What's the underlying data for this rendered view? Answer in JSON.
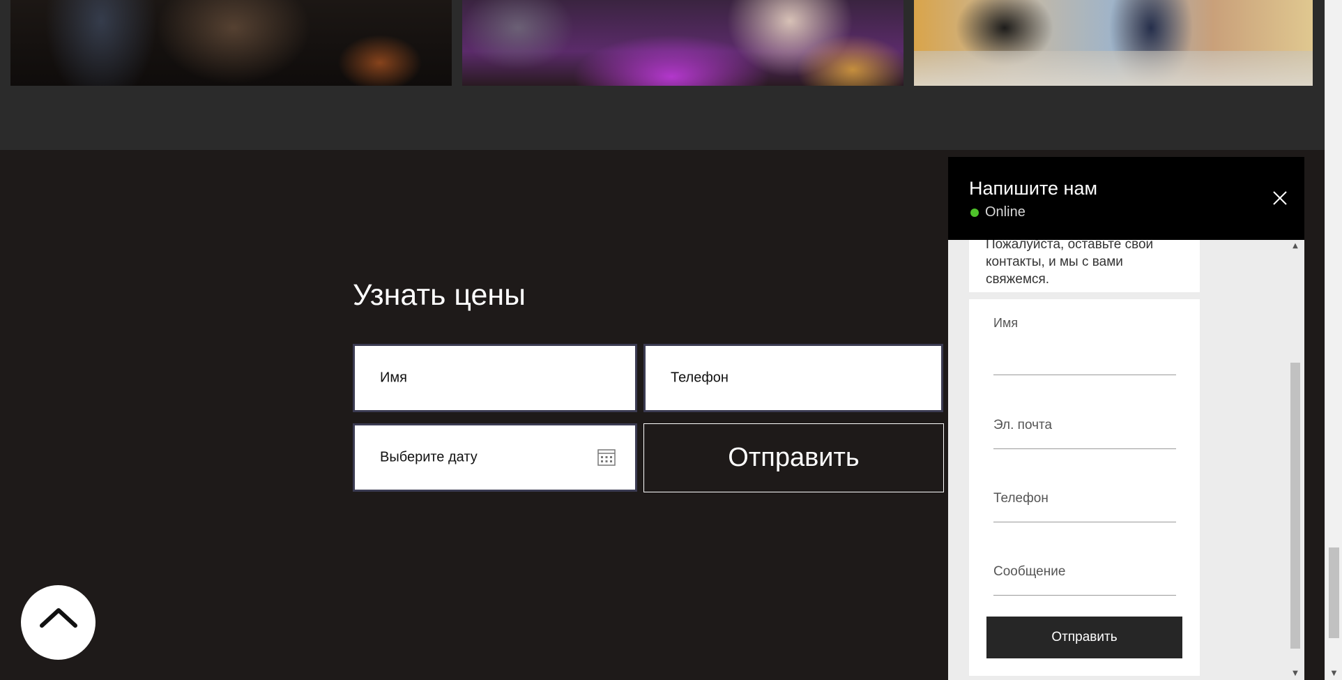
{
  "price_form": {
    "title": "Узнать цены",
    "name_placeholder": "Имя",
    "phone_placeholder": "Телефон",
    "date_placeholder": "Выберите дату",
    "submit_label": "Отправить"
  },
  "chat": {
    "title": "Напишите нам",
    "status": "Online",
    "message": "Пожалуйста, оставьте свои контакты, и мы с вами свяжемся.",
    "fields": {
      "name": "Имя",
      "email": "Эл. почта",
      "phone": "Телефон",
      "message": "Сообщение"
    },
    "submit_label": "Отправить"
  },
  "colors": {
    "background": "#1e1a19",
    "gallery_band": "#2b2b2b",
    "status_online": "#4fc32b",
    "chat_button": "#262626"
  },
  "icons": {
    "calendar": "calendar-icon",
    "close": "close-icon",
    "scroll_top": "chevron-up-icon"
  }
}
